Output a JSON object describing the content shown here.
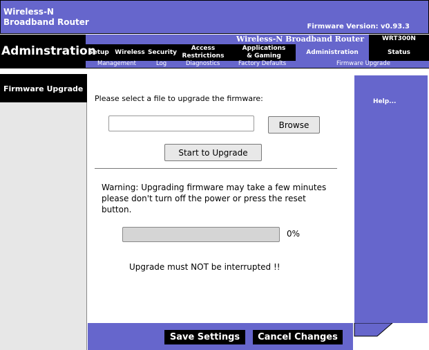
{
  "header": {
    "brand_line1": "Wireless-N",
    "brand_line2": "Broadband Router",
    "firmware_version": "Firmware Version: v0.93.3",
    "product_name": "Wireless-N Broadband Router",
    "model": "WRT300N",
    "page_title": "Adminstration"
  },
  "tabs": [
    {
      "label": "Setup"
    },
    {
      "label": "Wireless"
    },
    {
      "label": "Security"
    },
    {
      "label1": "Access",
      "label2": "Restrictions"
    },
    {
      "label1": "Applications",
      "label2": "& Gaming"
    },
    {
      "label": "Administration"
    },
    {
      "label": "Status"
    }
  ],
  "subnav": [
    {
      "label": "Management"
    },
    {
      "label": "Log"
    },
    {
      "label": "Diagnostics"
    },
    {
      "label": "Factory Defaults"
    },
    {
      "label": "Firmware Upgrade"
    }
  ],
  "sidebar": {
    "section_title": "Firmware Upgrade"
  },
  "main": {
    "prompt": "Please select a file to upgrade the firmware:",
    "file_value": "",
    "browse_label": "Browse",
    "upgrade_label": "Start to Upgrade",
    "warning": "Warning: Upgrading firmware may take a few minutes\nplease don't turn off the  power or press the reset\nbutton.",
    "progress_percent": 0,
    "progress_text": "0%",
    "interrupt_note": "Upgrade must NOT be interrupted !!"
  },
  "help": {
    "label": "Help..."
  },
  "footer": {
    "save_label": "Save Settings",
    "cancel_label": "Cancel Changes"
  },
  "colors": {
    "brand_purple": "#6666cc",
    "nav_black": "#000000"
  }
}
